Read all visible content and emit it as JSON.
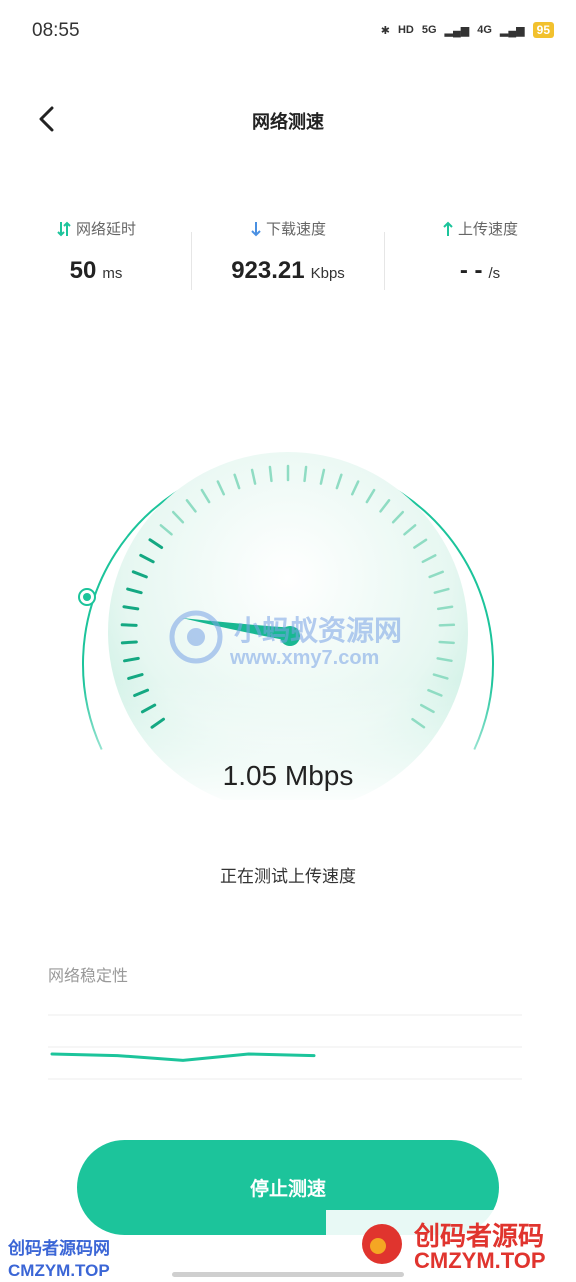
{
  "status_bar": {
    "time": "08:55",
    "hd": "HD",
    "net1": "5G",
    "net2": "4G",
    "battery": "95"
  },
  "header": {
    "title": "网络测速"
  },
  "metrics": [
    {
      "label": "网络延时",
      "value": "50",
      "unit": "ms"
    },
    {
      "label": "下载速度",
      "value": "923.21",
      "unit": "Kbps"
    },
    {
      "label": "上传速度",
      "value": "- -",
      "unit": "/s"
    }
  ],
  "gauge": {
    "speed": "1.05 Mbps",
    "status": "正在测试上传速度"
  },
  "stability": {
    "label": "网络稳定性",
    "values": [
      0.6,
      0.58,
      0.52,
      0.6,
      0.58
    ]
  },
  "actions": {
    "stop_label": "停止测速"
  },
  "watermarks": {
    "center_cn": "小蚂蚁资源网",
    "center_en": "www.xmy7.com",
    "left_cn": "创码者源码网",
    "left_en": "CMZYM.TOP",
    "right_cn": "创码者源码",
    "right_en": "CMZYM.TOP"
  },
  "colors": {
    "accent": "#1cc49b",
    "watermark_red": "#e0342e",
    "watermark_blue": "#3b66d6"
  }
}
